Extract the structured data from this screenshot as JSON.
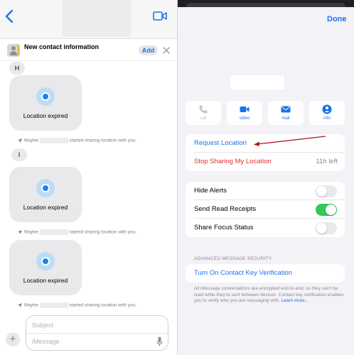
{
  "chat": {
    "contact_banner": {
      "title": "New contact information",
      "add_label": "Add"
    },
    "messages": [
      {
        "initial": "H",
        "location_label": "Location expired",
        "system_prefix": "Maybe:",
        "system_suffix": "started sharing location with you."
      },
      {
        "initial": "I",
        "location_label": "Location expired",
        "system_prefix": "Maybe:",
        "system_suffix": "started sharing location with you."
      },
      {
        "initial": "",
        "location_label": "Location expired",
        "system_prefix": "Maybe:",
        "system_suffix": "started sharing location with you."
      }
    ],
    "compose": {
      "subject_placeholder": "Subject",
      "message_placeholder": "iMessage",
      "plus_label": "+"
    }
  },
  "details": {
    "done_label": "Done",
    "actions": [
      {
        "label": "call",
        "icon": "phone-icon",
        "enabled": false
      },
      {
        "label": "video",
        "icon": "video-camera-icon",
        "enabled": true
      },
      {
        "label": "mail",
        "icon": "mail-icon",
        "enabled": true
      },
      {
        "label": "info",
        "icon": "info-icon",
        "enabled": true
      }
    ],
    "location": {
      "request_label": "Request Location",
      "stop_label": "Stop Sharing My Location",
      "stop_duration": "11h left"
    },
    "settings": [
      {
        "label": "Hide Alerts",
        "on": false
      },
      {
        "label": "Send Read Receipts",
        "on": true
      },
      {
        "label": "Share Focus Status",
        "on": false
      }
    ],
    "security": {
      "header": "ADVANCED MESSAGE SECURITY",
      "verification_label": "Turn On Contact Key Verification",
      "footer_text": "All iMessage conversations are encrypted end-to-end, so they can't be read while they're sent between devices. Contact key verification enables you to verify who you are messaging with.",
      "learn_more": "Learn more..."
    }
  },
  "colors": {
    "accent_blue": "#1a73e8",
    "destructive_red": "#e0302b",
    "toggle_on_green": "#34c759",
    "annotation_red": "#b3151b"
  }
}
